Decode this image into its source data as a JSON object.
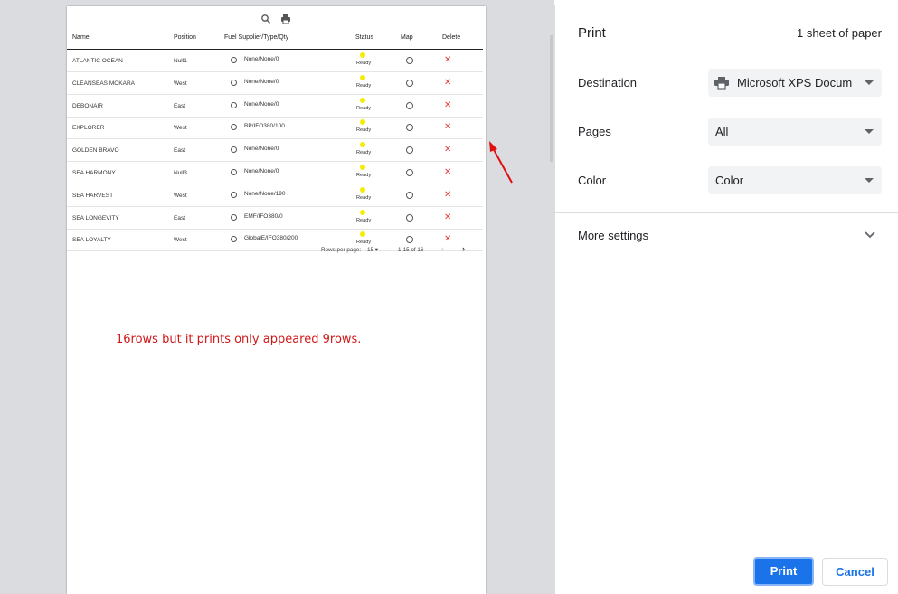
{
  "table": {
    "headers": {
      "name": "Name",
      "position": "Position",
      "fuel": "Fuel Supplier/Type/Qty",
      "status": "Status",
      "map": "Map",
      "delete": "Delete"
    },
    "rows": [
      {
        "name": "ATLANTIC OCEAN",
        "position": "Null1",
        "fuel": "None/None/0",
        "status": "Ready"
      },
      {
        "name": "CLEANSEAS MOKARA",
        "position": "West",
        "fuel": "None/None/0",
        "status": "Ready"
      },
      {
        "name": "DEBONAIR",
        "position": "East",
        "fuel": "None/None/0",
        "status": "Ready"
      },
      {
        "name": "EXPLORER",
        "position": "West",
        "fuel": "BP/IFO380/100",
        "status": "Ready"
      },
      {
        "name": "GOLDEN BRAVO",
        "position": "East",
        "fuel": "None/None/0",
        "status": "Ready"
      },
      {
        "name": "SEA HARMONY",
        "position": "Null3",
        "fuel": "None/None/0",
        "status": "Ready"
      },
      {
        "name": "SEA HARVEST",
        "position": "West",
        "fuel": "None/None/190",
        "status": "Ready"
      },
      {
        "name": "SEA LONGEVITY",
        "position": "East",
        "fuel": "EMF/IFO380/0",
        "status": "Ready"
      },
      {
        "name": "SEA LOYALTY",
        "position": "West",
        "fuel": "GlobalE/IFO380/200",
        "status": "Ready"
      }
    ],
    "delete_glyph": "✕",
    "status_color": "#f5ec00"
  },
  "pagination": {
    "rows_per_page_label": "Rows per page:",
    "rows_per_page_value": "15",
    "range": "1-15 of 16"
  },
  "annotation": "16rows but it prints only appeared 9rows.",
  "print": {
    "title": "Print",
    "sheets": "1 sheet of paper",
    "destination_label": "Destination",
    "destination_value": "Microsoft XPS Docum",
    "pages_label": "Pages",
    "pages_value": "All",
    "color_label": "Color",
    "color_value": "Color",
    "more_settings": "More settings",
    "print_button": "Print",
    "cancel_button": "Cancel"
  },
  "colors": {
    "accent": "#1a73e8",
    "annotation": "#d01818"
  }
}
